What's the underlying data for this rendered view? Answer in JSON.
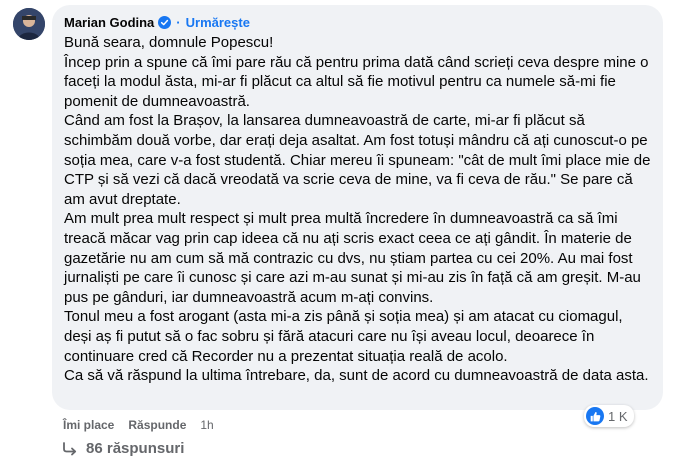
{
  "comment": {
    "author": "Marian Godina",
    "follow_label": "Urmărește",
    "separator": "·",
    "paragraphs": [
      "Bună seara, domnule Popescu!",
      "Încep prin a spune că îmi pare rău că pentru prima dată când scrieți ceva despre mine o faceți la modul ăsta, mi-ar fi plăcut ca altul să fie motivul pentru ca numele să-mi fie pomenit de dumneavoastră.",
      "Când am fost la Brașov, la lansarea dumneavoastră de carte, mi-ar fi plăcut să schimbăm două vorbe, dar erați deja asaltat. Am fost totuși mândru că ați cunoscut-o pe soția mea, care v-a fost studentă. Chiar mereu îi spuneam: \"cât de mult îmi place mie de CTP și să vezi că dacă vreodată va scrie ceva de mine, va fi ceva de rău.\" Se pare că am avut dreptate.",
      "Am mult prea mult respect și mult prea multă încredere în dumneavoastră ca să îmi treacă măcar vag prin cap ideea că nu ați scris exact ceea ce ați gândit. În materie de gazetărie nu am cum să mă contrazic cu dvs, nu știam partea cu cei 20%. Au mai fost jurnaliști pe care îi cunosc și care azi m-au sunat și mi-au zis în față că am greșit. M-au pus pe gânduri, iar dumneavoastră acum m-ați convins.",
      "Tonul meu a fost arogant (asta mi-a zis până și soția mea) și am atacat cu ciomagul, deși aș fi putut să o fac sobru și fără atacuri care nu își aveau locul, deoarece în continuare cred că Recorder nu a prezentat situația reală de acolo.",
      "Ca să vă răspund la ultima întrebare, da, sunt de acord cu dumneavoastră de data asta."
    ],
    "reactions_count": "1 K",
    "like_label": "Îmi place",
    "reply_label": "Răspunde",
    "time": "1h",
    "replies_label": "86 răspunsuri"
  },
  "colors": {
    "bubble": "#f0f2f5",
    "accent": "#1877f2",
    "muted": "#65676b",
    "text": "#050505"
  },
  "icons": {
    "avatar": "avatar",
    "verified": "verified-badge-icon",
    "like": "thumbs-up-icon",
    "reply_arrow": "reply-arrow-icon"
  }
}
